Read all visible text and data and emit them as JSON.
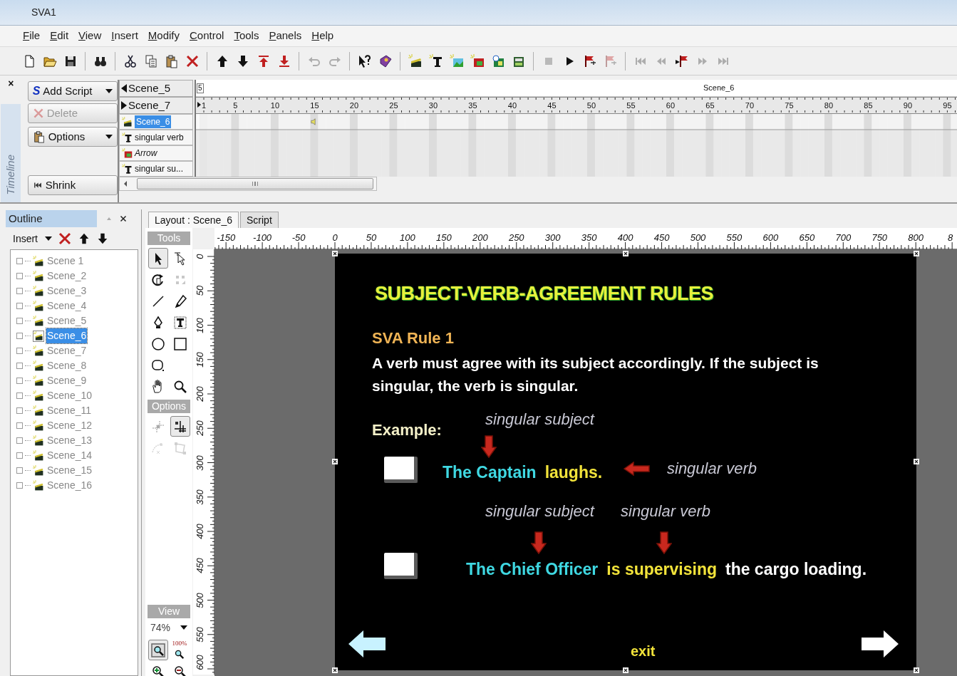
{
  "window": {
    "title": "SVA1"
  },
  "menu": [
    {
      "label": "File"
    },
    {
      "label": "Edit"
    },
    {
      "label": "View"
    },
    {
      "label": "Insert"
    },
    {
      "label": "Modify"
    },
    {
      "label": "Control"
    },
    {
      "label": "Tools"
    },
    {
      "label": "Panels"
    },
    {
      "label": "Help"
    }
  ],
  "toolbar": [
    {
      "kind": "new",
      "disabled": false
    },
    {
      "kind": "open",
      "disabled": false
    },
    {
      "kind": "save",
      "disabled": false
    },
    {
      "kind": "sep"
    },
    {
      "kind": "find",
      "disabled": false
    },
    {
      "kind": "sep"
    },
    {
      "kind": "cut",
      "disabled": false
    },
    {
      "kind": "copy",
      "disabled": false
    },
    {
      "kind": "paste",
      "disabled": false
    },
    {
      "kind": "delete",
      "disabled": false
    },
    {
      "kind": "sep"
    },
    {
      "kind": "up",
      "disabled": false
    },
    {
      "kind": "down",
      "disabled": false
    },
    {
      "kind": "top",
      "disabled": false
    },
    {
      "kind": "bottom",
      "disabled": false
    },
    {
      "kind": "sep"
    },
    {
      "kind": "undo",
      "disabled": true
    },
    {
      "kind": "redo",
      "disabled": true
    },
    {
      "kind": "sep"
    },
    {
      "kind": "help",
      "disabled": false
    },
    {
      "kind": "book",
      "disabled": false
    },
    {
      "kind": "sep"
    },
    {
      "kind": "scene",
      "disabled": false
    },
    {
      "kind": "text",
      "disabled": false
    },
    {
      "kind": "image",
      "disabled": false
    },
    {
      "kind": "image2",
      "disabled": false
    },
    {
      "kind": "image3",
      "disabled": false
    },
    {
      "kind": "image4",
      "disabled": false
    },
    {
      "kind": "sep"
    },
    {
      "kind": "stop",
      "disabled": true
    },
    {
      "kind": "play",
      "disabled": false
    },
    {
      "kind": "flag",
      "disabled": false
    },
    {
      "kind": "flag",
      "disabled": true
    },
    {
      "kind": "sep"
    },
    {
      "kind": "first",
      "disabled": true
    },
    {
      "kind": "prev",
      "disabled": true
    },
    {
      "kind": "flag-next",
      "disabled": false
    },
    {
      "kind": "fwd",
      "disabled": true
    },
    {
      "kind": "last",
      "disabled": true
    }
  ],
  "timeline": {
    "close": "×",
    "panel_label": "Timeline",
    "buttons": [
      {
        "label": "Add Script",
        "kind": "dropdown",
        "icon_glyph": "S",
        "disabled": false
      },
      {
        "label": "Delete",
        "kind": "delete",
        "disabled": true
      },
      {
        "label": "Options",
        "kind": "dropdown",
        "disabled": false
      },
      {
        "label": "Shrink",
        "kind": "shrink",
        "disabled": false
      }
    ],
    "scene_nav": [
      {
        "label": "Scene_5",
        "kind": "prev"
      },
      {
        "label": "Scene_7",
        "kind": "next"
      }
    ],
    "layers": [
      {
        "name": "Scene_6",
        "kind": "scene",
        "selected": true,
        "italic": false
      },
      {
        "name": "singular verb",
        "kind": "text",
        "selected": false,
        "italic": false
      },
      {
        "name": "Arrow",
        "kind": "image",
        "selected": false,
        "italic": true
      },
      {
        "name": "singular su...",
        "kind": "text",
        "selected": false,
        "italic": false
      }
    ],
    "marker": "5",
    "scene_label": "Scene_6",
    "frame_numbers": [
      "1",
      "5",
      "10",
      "15",
      "20",
      "25",
      "30",
      "35",
      "40",
      "45",
      "50",
      "55",
      "60",
      "65",
      "70",
      "75",
      "80",
      "85",
      "90",
      "95"
    ]
  },
  "outline": {
    "title": "Outline",
    "insert": "Insert",
    "scenes": [
      {
        "name": "Scene 1",
        "selected": false,
        "expanded": false
      },
      {
        "name": "Scene_2",
        "selected": false,
        "expanded": false
      },
      {
        "name": "Scene_3",
        "selected": false,
        "expanded": false
      },
      {
        "name": "Scene_4",
        "selected": false,
        "expanded": false
      },
      {
        "name": "Scene_5",
        "selected": false,
        "expanded": false
      },
      {
        "name": "Scene_6",
        "selected": true,
        "expanded": false
      },
      {
        "name": "Scene_7",
        "selected": false,
        "expanded": false
      },
      {
        "name": "Scene_8",
        "selected": false,
        "expanded": false
      },
      {
        "name": "Scene_9",
        "selected": false,
        "expanded": false
      },
      {
        "name": "Scene_10",
        "selected": false,
        "expanded": false
      },
      {
        "name": "Scene_11",
        "selected": false,
        "expanded": false
      },
      {
        "name": "Scene_12",
        "selected": false,
        "expanded": false
      },
      {
        "name": "Scene_13",
        "selected": false,
        "expanded": false
      },
      {
        "name": "Scene_14",
        "selected": false,
        "expanded": false
      },
      {
        "name": "Scene_15",
        "selected": false,
        "expanded": false
      },
      {
        "name": "Scene_16",
        "selected": false,
        "expanded": false
      }
    ]
  },
  "layout": {
    "tabs": [
      {
        "label": "Layout : Scene_6",
        "selected": true
      },
      {
        "label": "Script",
        "selected": false
      }
    ],
    "tools_header": "Tools",
    "tools": [
      {
        "kind": "arrow",
        "selected": true,
        "disabled": false
      },
      {
        "kind": "subselect",
        "selected": false,
        "disabled": false
      },
      {
        "kind": "rotate",
        "selected": false,
        "disabled": false
      },
      {
        "kind": "transform",
        "selected": false,
        "disabled": true
      },
      {
        "kind": "line",
        "selected": false,
        "disabled": false
      },
      {
        "kind": "pencil",
        "selected": false,
        "disabled": false
      },
      {
        "kind": "pen",
        "selected": false,
        "disabled": false
      },
      {
        "kind": "texttool",
        "selected": false,
        "disabled": false
      },
      {
        "kind": "oval",
        "selected": false,
        "disabled": false
      },
      {
        "kind": "rect",
        "selected": false,
        "disabled": false
      },
      {
        "kind": "roundrect",
        "selected": false,
        "disabled": false
      },
      {
        "kind": "blank"
      },
      {
        "kind": "hand",
        "selected": false,
        "disabled": false
      },
      {
        "kind": "zoom",
        "selected": false,
        "disabled": false
      }
    ],
    "options_header": "Options",
    "options": [
      {
        "kind": "snapalign",
        "selected": false,
        "disabled": false
      },
      {
        "kind": "snap",
        "selected": true,
        "disabled": false
      },
      {
        "kind": "smooth",
        "selected": false,
        "disabled": true
      },
      {
        "kind": "distort",
        "selected": false,
        "disabled": true
      }
    ],
    "view_header": "View",
    "zoom": "74%",
    "view_tools": [
      {
        "kind": "zoomfit",
        "selected": true
      },
      {
        "kind": "zoom100",
        "label": "100%",
        "selected": false
      },
      {
        "kind": "zoomin",
        "selected": false
      },
      {
        "kind": "zoomout",
        "selected": false
      }
    ],
    "h_ruler": [
      "-150",
      "-100",
      "-50",
      "0",
      "50",
      "100",
      "150",
      "200",
      "250",
      "300",
      "350",
      "400",
      "450",
      "500",
      "550",
      "600",
      "650",
      "700",
      "750",
      "800",
      "8"
    ],
    "v_ruler": [
      "0",
      "50",
      "100",
      "150",
      "200",
      "250",
      "300",
      "350",
      "400",
      "450",
      "500",
      "550",
      "600"
    ]
  },
  "slide": {
    "title": "SUBJECT-VERB-AGREEMENT RULES",
    "rule": "SVA Rule 1",
    "statement": "A verb must agree with its subject accordingly. If the subject is singular, the verb is singular.",
    "example_label": "Example:",
    "examples": [
      {
        "kind": "side_note",
        "notes": [
          "singular subject",
          "singular verb"
        ],
        "subject": "The Captain",
        "verb": "laughs."
      },
      {
        "kind": "notes_above",
        "notes": [
          "singular subject",
          "singular verb"
        ],
        "subject": "The Chief Officer",
        "verb": "is supervising",
        "rest": "the cargo loading."
      }
    ],
    "exit": "exit"
  }
}
